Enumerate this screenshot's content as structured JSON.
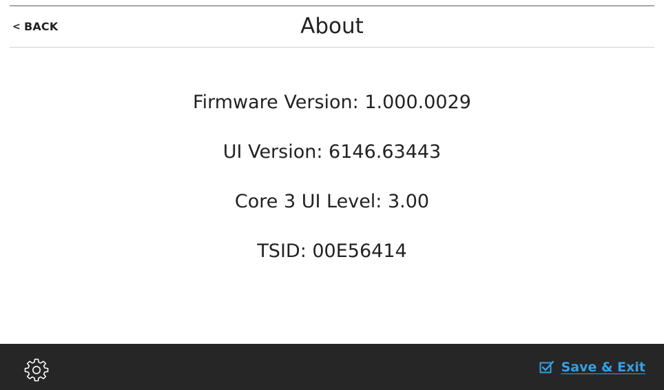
{
  "header": {
    "back_chevron": "<",
    "back_label": "BACK",
    "title": "About"
  },
  "info": {
    "lines": [
      "Firmware Version: 1.000.0029",
      "UI Version: 6146.63443",
      "Core 3 UI Level: 3.00",
      "TSID: 00E56414"
    ]
  },
  "footer": {
    "settings_icon": "gear-icon",
    "save_icon": "checkbox-checked-icon",
    "save_label": "Save & Exit"
  },
  "colors": {
    "footer_bg": "#262626",
    "accent": "#33a1e6",
    "text": "#222222"
  }
}
